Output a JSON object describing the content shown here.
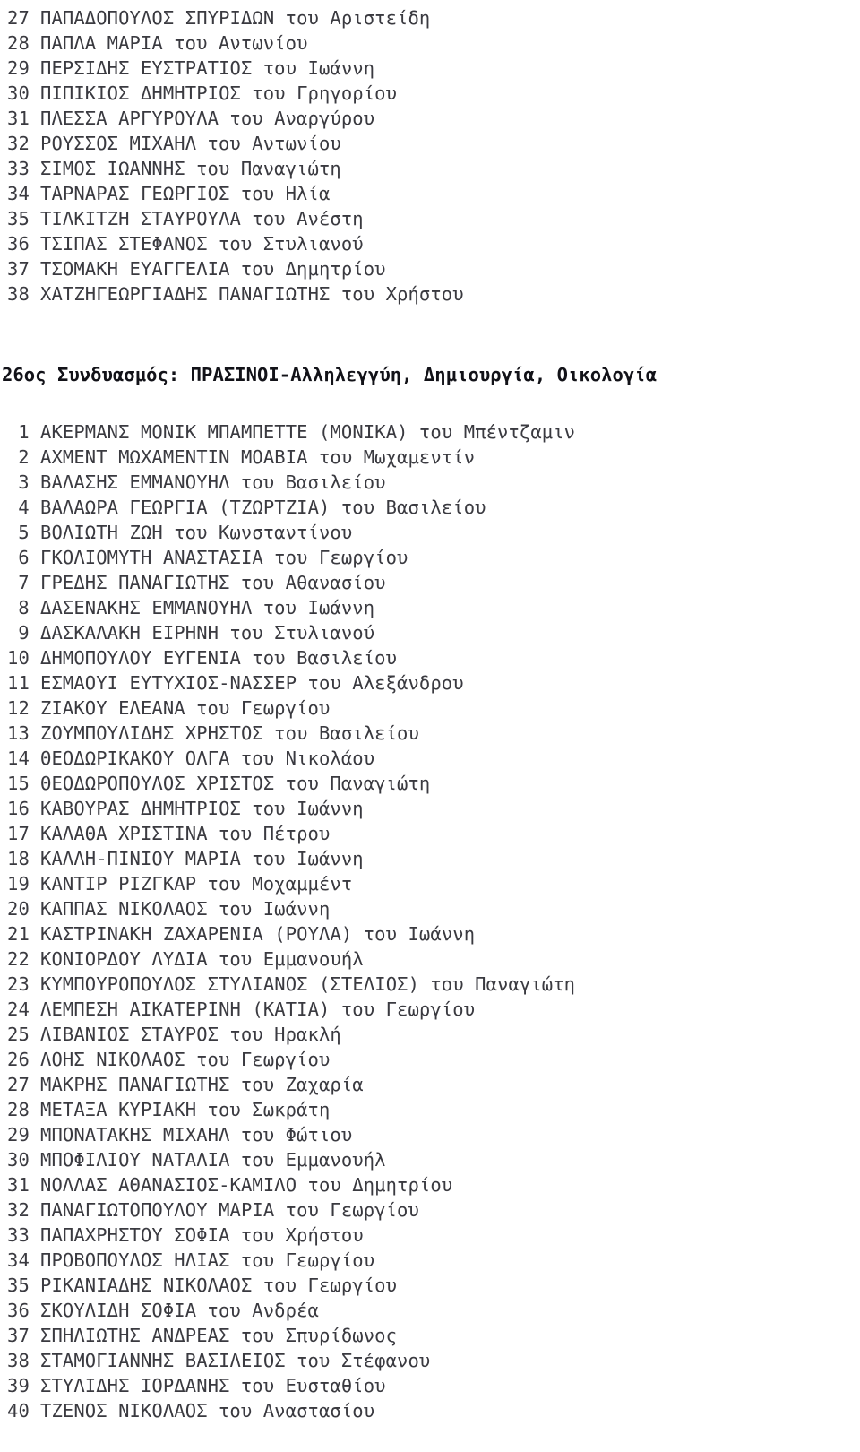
{
  "document": {
    "type": "electoral-candidate-list",
    "language": "el",
    "background_color": "#ffffff",
    "text_color": "#3a3a40",
    "heading_color": "#121218"
  },
  "previous_section": {
    "name": "previous-combination-list-continued",
    "items": [
      {
        "num": "27",
        "name": "ΠΑΠΑΔΟΠΟΥΛΟΣ ΣΠΥΡΙΔΩΝ",
        "patronymic": "του Αριστείδη"
      },
      {
        "num": "28",
        "name": "ΠΑΠΛΑ ΜΑΡΙΑ",
        "patronymic": "του Αντωνίου"
      },
      {
        "num": "29",
        "name": "ΠΕΡΣΙΔΗΣ ΕΥΣΤΡΑΤΙΟΣ",
        "patronymic": "του Ιωάννη"
      },
      {
        "num": "30",
        "name": "ΠΙΠΙΚΙΟΣ ΔΗΜΗΤΡΙΟΣ",
        "patronymic": "του Γρηγορίου"
      },
      {
        "num": "31",
        "name": "ΠΛΕΣΣΑ ΑΡΓΥΡΟΥΛΑ",
        "patronymic": "του Αναργύρου"
      },
      {
        "num": "32",
        "name": "ΡΟΥΣΣΟΣ ΜΙΧΑΗΛ",
        "patronymic": "του Αντωνίου"
      },
      {
        "num": "33",
        "name": "ΣΙΜΟΣ ΙΩΑΝΝΗΣ",
        "patronymic": "του Παναγιώτη"
      },
      {
        "num": "34",
        "name": "ΤΑΡΝΑΡΑΣ ΓΕΩΡΓΙΟΣ",
        "patronymic": "του Ηλία"
      },
      {
        "num": "35",
        "name": "ΤΙΛΚΙΤΖΗ ΣΤΑΥΡΟΥΛΑ",
        "patronymic": "του Ανέστη"
      },
      {
        "num": "36",
        "name": "ΤΣΙΠΑΣ ΣΤΕΦΑΝΟΣ",
        "patronymic": "του Στυλιανού"
      },
      {
        "num": "37",
        "name": "ΤΣΟΜΑΚΗ ΕΥΑΓΓΕΛΙΑ",
        "patronymic": "του Δημητρίου"
      },
      {
        "num": "38",
        "name": "ΧΑΤΖΗΓΕΩΡΓΙΑΔΗΣ ΠΑΝΑΓΙΩΤΗΣ",
        "patronymic": "του Χρήστου"
      }
    ]
  },
  "section": {
    "name": "combination-26",
    "heading_number": "26ος",
    "heading_label": "Συνδυασμός:",
    "heading_party": "ΠΡΑΣΙΝΟΙ-Αλληλεγγύη, Δημιουργία, Οικολογία",
    "heading_full": "26ος Συνδυασμός: ΠΡΑΣΙΝΟΙ-Αλληλεγγύη, Δημιουργία, Οικολογία",
    "items": [
      {
        "num": "1",
        "name": "ΑΚΕΡΜΑΝΣ ΜΟΝΙΚ ΜΠΑΜΠΕΤΤΕ (ΜΟΝΙΚΑ)",
        "patronymic": "του Μπέντζαμιν"
      },
      {
        "num": "2",
        "name": "ΑΧΜΕΝΤ ΜΩΧΑΜΕΝΤΙΝ ΜΟΑΒΙΑ",
        "patronymic": "του Μωχαμεντίν"
      },
      {
        "num": "3",
        "name": "ΒΑΛΑΣΗΣ ΕΜΜΑΝΟΥΗΛ",
        "patronymic": "του Βασιλείου"
      },
      {
        "num": "4",
        "name": "ΒΑΛΑΩΡΑ ΓΕΩΡΓΙΑ (ΤΖΩΡΤΖΙΑ)",
        "patronymic": "του Βασιλείου"
      },
      {
        "num": "5",
        "name": "ΒΟΛΙΩΤΗ ΖΩΗ",
        "patronymic": "του Κωνσταντίνου"
      },
      {
        "num": "6",
        "name": "ΓΚΟΛΙΟΜΥΤΗ ΑΝΑΣΤΑΣΙΑ",
        "patronymic": "του Γεωργίου"
      },
      {
        "num": "7",
        "name": "ΓΡΕΔΗΣ ΠΑΝΑΓΙΩΤΗΣ",
        "patronymic": "του Αθανασίου"
      },
      {
        "num": "8",
        "name": "ΔΑΣΕΝΑΚΗΣ ΕΜΜΑΝΟΥΗΛ",
        "patronymic": "του Ιωάννη"
      },
      {
        "num": "9",
        "name": "ΔΑΣΚΑΛΑΚΗ ΕΙΡΗΝΗ",
        "patronymic": "του Στυλιανού"
      },
      {
        "num": "10",
        "name": "ΔΗΜΟΠΟΥΛΟΥ ΕΥΓΕΝΙΑ",
        "patronymic": "του Βασιλείου"
      },
      {
        "num": "11",
        "name": "ΕΣΜΑΟΥΙ ΕΥΤΥΧΙΟΣ-ΝΑΣΣΕΡ",
        "patronymic": "του Αλεξάνδρου"
      },
      {
        "num": "12",
        "name": "ΖΙΑΚΟΥ ΕΛΕΑΝΑ",
        "patronymic": "του Γεωργίου"
      },
      {
        "num": "13",
        "name": "ΖΟΥΜΠΟΥΛΙΔΗΣ ΧΡΗΣΤΟΣ",
        "patronymic": "του Βασιλείου"
      },
      {
        "num": "14",
        "name": "ΘΕΟΔΩΡΙΚΑΚΟΥ ΟΛΓΑ",
        "patronymic": "του Νικολάου"
      },
      {
        "num": "15",
        "name": "ΘΕΟΔΩΡΟΠΟΥΛΟΣ ΧΡΙΣΤΟΣ",
        "patronymic": "του Παναγιώτη"
      },
      {
        "num": "16",
        "name": "ΚΑΒΟΥΡΑΣ ΔΗΜΗΤΡΙΟΣ",
        "patronymic": "του Ιωάννη"
      },
      {
        "num": "17",
        "name": "ΚΑΛΑΘΑ ΧΡΙΣΤΙΝΑ",
        "patronymic": "του Πέτρου"
      },
      {
        "num": "18",
        "name": "ΚΑΛΛΗ-ΠΙΝΙΟΥ ΜΑΡΙΑ",
        "patronymic": "του Ιωάννη"
      },
      {
        "num": "19",
        "name": "ΚΑΝΤΙΡ ΡΙΖΓΚΑΡ",
        "patronymic": "του Μοχαμμέντ"
      },
      {
        "num": "20",
        "name": "ΚΑΠΠΑΣ ΝΙΚΟΛΑΟΣ",
        "patronymic": "του Ιωάννη"
      },
      {
        "num": "21",
        "name": "ΚΑΣΤΡΙΝΑΚΗ ΖΑΧΑΡΕΝΙΑ (ΡΟΥΛΑ)",
        "patronymic": "του Ιωάννη"
      },
      {
        "num": "22",
        "name": "ΚΟΝΙΟΡΔΟΥ ΛΥΔΙΑ",
        "patronymic": "του Εμμανουήλ"
      },
      {
        "num": "23",
        "name": "ΚΥΜΠΟΥΡΟΠΟΥΛΟΣ ΣΤΥΛΙΑΝΟΣ (ΣΤΕΛΙΟΣ)",
        "patronymic": "του Παναγιώτη"
      },
      {
        "num": "24",
        "name": "ΛΕΜΠΕΣΗ ΑΙΚΑΤΕΡΙΝΗ (ΚΑΤΙΑ)",
        "patronymic": "του Γεωργίου"
      },
      {
        "num": "25",
        "name": "ΛΙΒΑΝΙΟΣ ΣΤΑΥΡΟΣ",
        "patronymic": "του Ηρακλή"
      },
      {
        "num": "26",
        "name": "ΛΟΗΣ ΝΙΚΟΛΑΟΣ",
        "patronymic": "του Γεωργίου"
      },
      {
        "num": "27",
        "name": "ΜΑΚΡΗΣ ΠΑΝΑΓΙΩΤΗΣ",
        "patronymic": "του Ζαχαρία"
      },
      {
        "num": "28",
        "name": "ΜΕΤΑΞΑ ΚΥΡΙΑΚΗ",
        "patronymic": "του Σωκράτη"
      },
      {
        "num": "29",
        "name": "ΜΠΟΝΑΤΑΚΗΣ ΜΙΧΑΗΛ",
        "patronymic": "του Φώτιου"
      },
      {
        "num": "30",
        "name": "ΜΠΟΦΙΛΙΟΥ ΝΑΤΑΛΙΑ",
        "patronymic": "του Εμμανουήλ"
      },
      {
        "num": "31",
        "name": "ΝΟΛΛΑΣ ΑΘΑΝΑΣΙΟΣ-ΚΑΜΙΛΟ",
        "patronymic": "του Δημητρίου"
      },
      {
        "num": "32",
        "name": "ΠΑΝΑΓΙΩΤΟΠΟΥΛΟΥ ΜΑΡΙΑ",
        "patronymic": "του Γεωργίου"
      },
      {
        "num": "33",
        "name": "ΠΑΠΑΧΡΗΣΤΟΥ ΣΟΦΙΑ",
        "patronymic": "του Χρήστου"
      },
      {
        "num": "34",
        "name": "ΠΡΟΒΟΠΟΥΛΟΣ ΗΛΙΑΣ",
        "patronymic": "του Γεωργίου"
      },
      {
        "num": "35",
        "name": "ΡΙΚΑΝΙΑΔΗΣ ΝΙΚΟΛΑΟΣ",
        "patronymic": "του Γεωργίου"
      },
      {
        "num": "36",
        "name": "ΣΚΟΥΛΙΔΗ ΣΟΦΙΑ",
        "patronymic": "του Ανδρέα"
      },
      {
        "num": "37",
        "name": "ΣΠΗΛΙΩΤΗΣ ΑΝΔΡΕΑΣ",
        "patronymic": "του Σπυρίδωνος"
      },
      {
        "num": "38",
        "name": "ΣΤΑΜΟΓΙΑΝΝΗΣ ΒΑΣΙΛΕΙΟΣ",
        "patronymic": "του Στέφανου"
      },
      {
        "num": "39",
        "name": "ΣΤΥΛΙΔΗΣ ΙΟΡΔΑΝΗΣ",
        "patronymic": "του Ευσταθίου"
      },
      {
        "num": "40",
        "name": "ΤΖΕΝΟΣ ΝΙΚΟΛΑΟΣ",
        "patronymic": "του Αναστασίου"
      }
    ]
  }
}
